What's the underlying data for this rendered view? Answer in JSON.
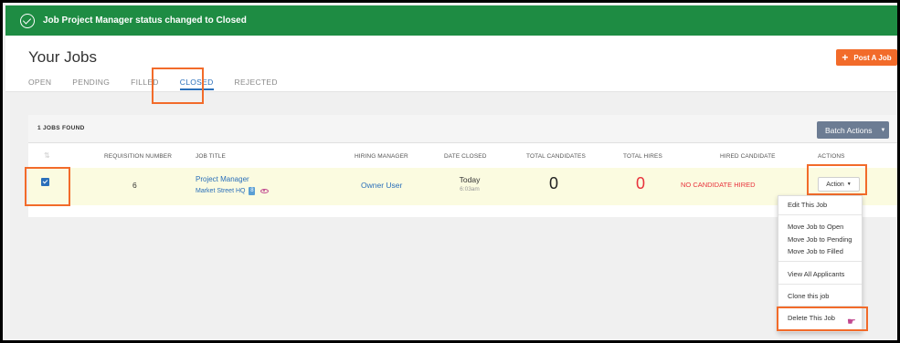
{
  "banner": {
    "message": "Job Project Manager status changed to Closed"
  },
  "header": {
    "title": "Your Jobs",
    "post_job_label": "Post A Job",
    "tabs": [
      {
        "label": "OPEN"
      },
      {
        "label": "PENDING"
      },
      {
        "label": "FILLED"
      },
      {
        "label": "CLOSED",
        "active": true
      },
      {
        "label": "REJECTED"
      }
    ]
  },
  "toolbar": {
    "jobs_found": "1 JOBS FOUND",
    "batch_actions_label": "Batch Actions"
  },
  "table": {
    "columns": [
      "REQUISITION NUMBER",
      "JOB TITLE",
      "HIRING MANAGER",
      "DATE CLOSED",
      "TOTAL CANDIDATES",
      "TOTAL HIRES",
      "HIRED CANDIDATE",
      "ACTIONS"
    ],
    "rows": [
      {
        "requisition_number": "6",
        "job_title": "Project Manager",
        "location": "Market Street HQ",
        "location_badge": "8",
        "hiring_manager": "Owner User",
        "date_closed": "Today",
        "date_closed_time": "6:03am",
        "total_candidates": "0",
        "total_hires": "0",
        "hired_candidate": "NO CANDIDATE HIRED",
        "action_label": "Action"
      }
    ]
  },
  "action_menu": {
    "items": [
      "Edit This Job",
      "Move Job to Open",
      "Move Job to Pending",
      "Move Job to Filled",
      "View All Applicants",
      "Clone this job",
      "Delete This Job"
    ]
  },
  "colors": {
    "banner": "#1e8c43",
    "accent": "#f26b2a",
    "link": "#2a6fba",
    "danger": "#e8323c",
    "batch": "#6c7c93"
  }
}
